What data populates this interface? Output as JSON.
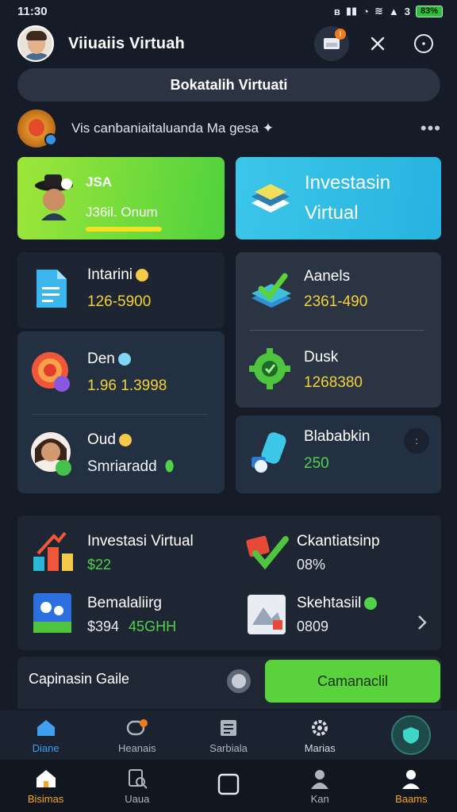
{
  "status": {
    "time": "11:30",
    "battery": "83%",
    "sim_label": "3"
  },
  "header": {
    "title": "Viiuaiis Virtuah"
  },
  "banner": {
    "label": "Bokatalih Virtuati"
  },
  "promo": {
    "text": "Vis canbaniaitaluanda Ma gesa ✦",
    "more": "•••"
  },
  "cards": {
    "green": {
      "label": "JSA",
      "value": "J36il. Onum"
    },
    "blue": {
      "title_line1": "Investasin",
      "title_line2": "Virtual"
    }
  },
  "tiles": {
    "left_top": {
      "label": "Intarini",
      "value": "126-5900"
    },
    "left_mid": {
      "label": "Den",
      "value": "1.96 1.3998"
    },
    "left_bot": {
      "label": "Oud",
      "value": "Smriaradd"
    },
    "right_top": {
      "label": "Aanels",
      "value": "2361-490"
    },
    "right_mid": {
      "label": "Dusk",
      "value": "1268380"
    },
    "right_bot": {
      "label": "Blababkin",
      "value": "250"
    }
  },
  "list": {
    "item1": {
      "label": "Investasi Virtual",
      "value": "$22"
    },
    "item2": {
      "label": "Ckantiatsinp",
      "value": "08%"
    },
    "item3": {
      "label": "Bemalaliirg",
      "value": "$394",
      "value2": "45GHH"
    },
    "item4": {
      "label": "Skehtasiil",
      "value": "0809"
    }
  },
  "action": {
    "label": "Capinasin Gaile",
    "cta": "Camanaclil"
  },
  "nav_top": [
    {
      "label": "Diane"
    },
    {
      "label": "Heanais"
    },
    {
      "label": "Sarbiala"
    },
    {
      "label": "Marias"
    },
    {
      "label": ""
    }
  ],
  "nav_bottom": [
    {
      "label": "Bisimas"
    },
    {
      "label": "Uaua"
    },
    {
      "label": ""
    },
    {
      "label": "Kan"
    },
    {
      "label": "Baams"
    }
  ],
  "colors": {
    "accent_green": "#5ad23b",
    "accent_blue": "#27b3df",
    "value_yellow": "#f2d13a",
    "nav_active": "#3ea0ee"
  }
}
